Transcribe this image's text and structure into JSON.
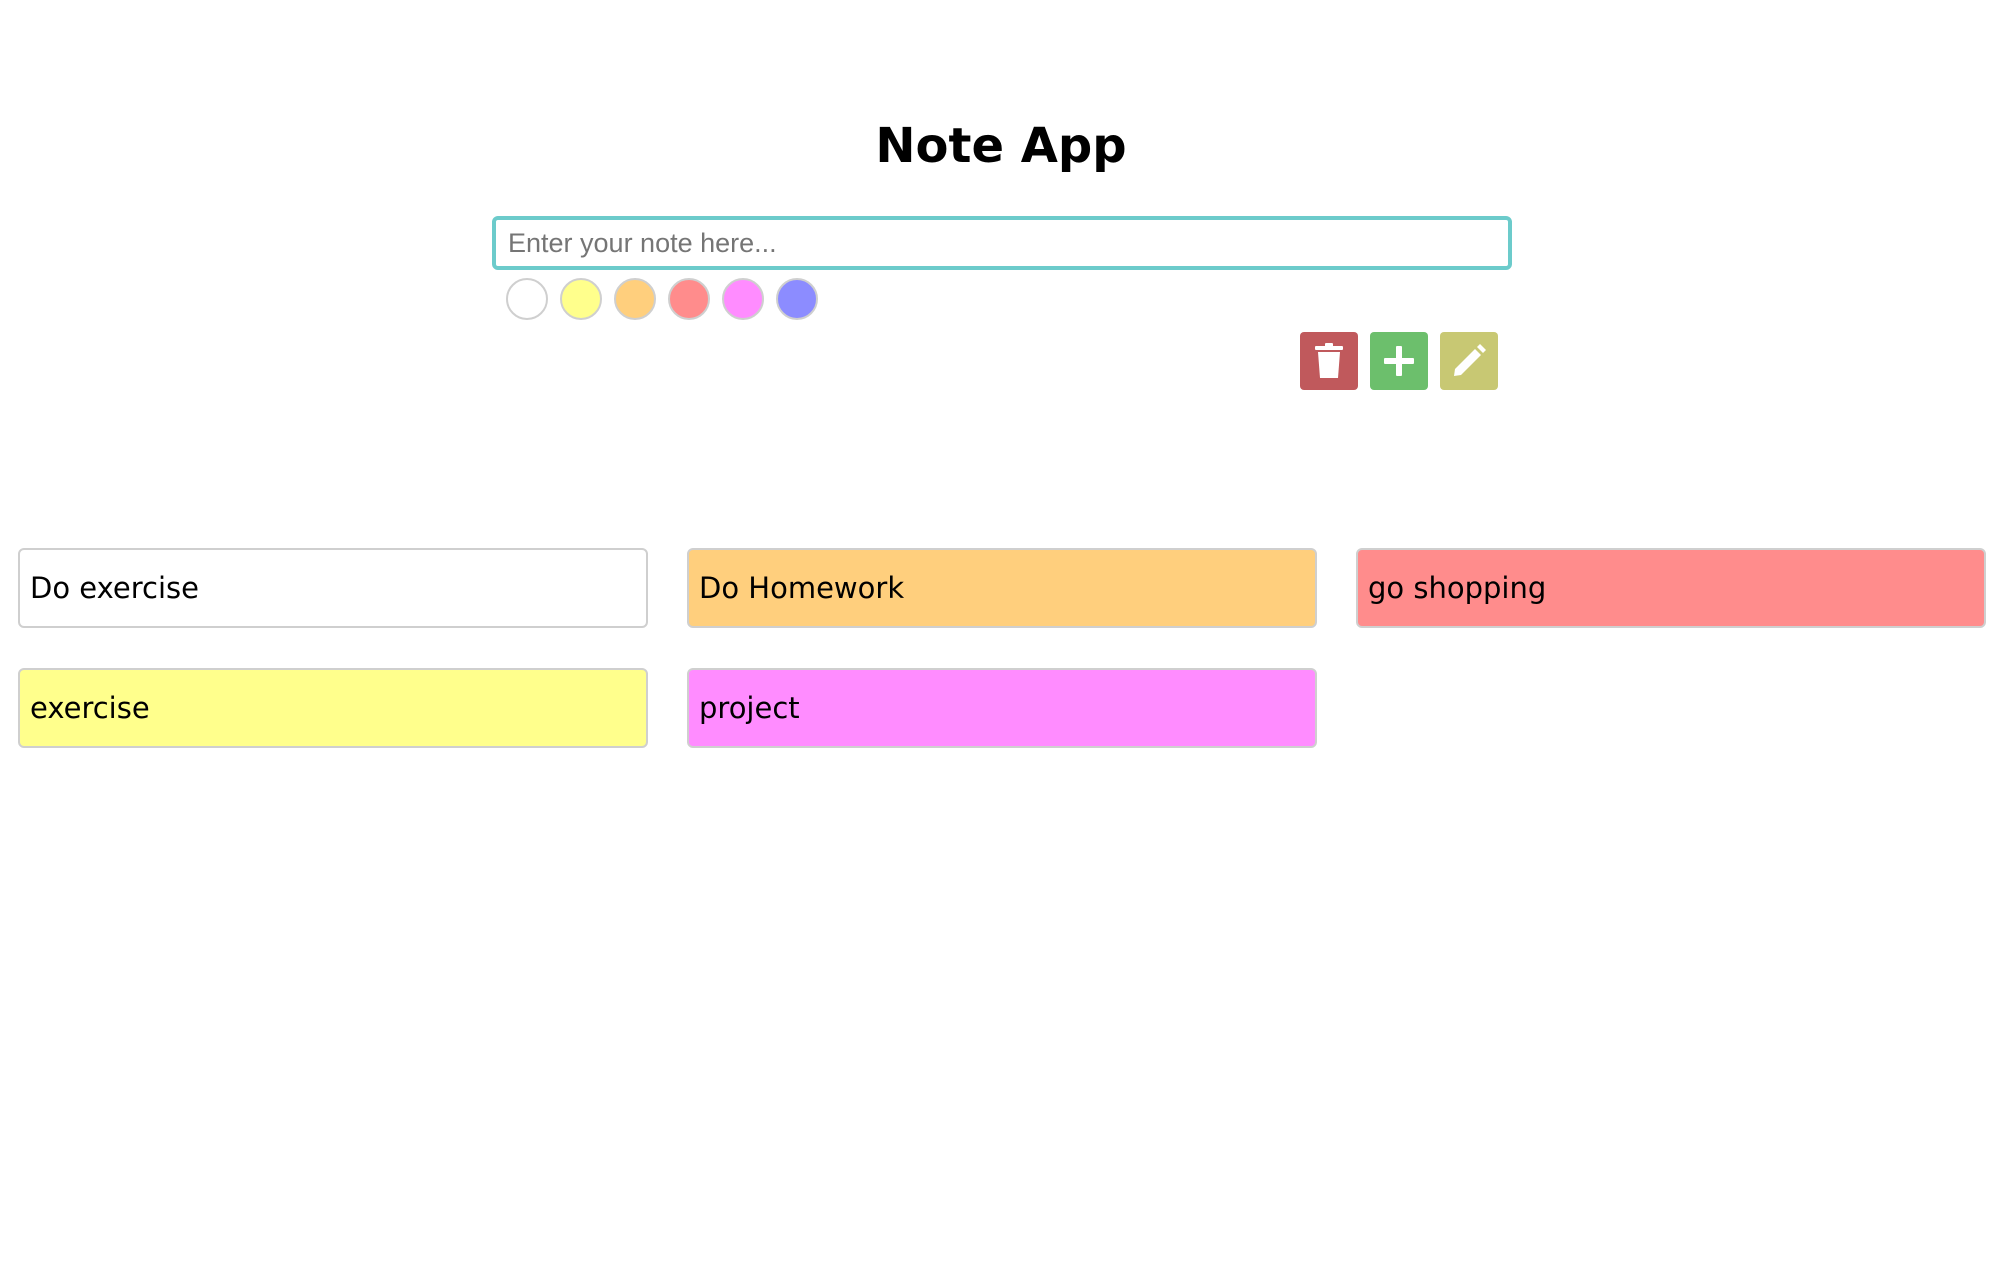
{
  "app": {
    "title": "Note App"
  },
  "input": {
    "placeholder": "Enter your note here...",
    "value": "",
    "border_color": "#6ccbcb"
  },
  "swatches": [
    {
      "name": "white",
      "color": "#ffffff"
    },
    {
      "name": "yellow",
      "color": "#ffff8c"
    },
    {
      "name": "orange",
      "color": "#ffcf7d"
    },
    {
      "name": "red",
      "color": "#ff8c8c"
    },
    {
      "name": "pink",
      "color": "#ff8cff"
    },
    {
      "name": "blue",
      "color": "#8c8cff"
    }
  ],
  "actions": [
    {
      "name": "delete-button",
      "icon": "trash-icon",
      "color": "#c0595c"
    },
    {
      "name": "add-button",
      "icon": "plus-icon",
      "color": "#6cbf6c"
    },
    {
      "name": "edit-button",
      "icon": "pencil-icon",
      "color": "#c8c873"
    }
  ],
  "notes": [
    {
      "text": "Do exercise",
      "color": "#ffffff"
    },
    {
      "text": "Do Homework",
      "color": "#ffcf7d"
    },
    {
      "text": "go shopping",
      "color": "#ff8c8c"
    },
    {
      "text": "exercise",
      "color": "#ffff8c"
    },
    {
      "text": "project",
      "color": "#ff8cff"
    }
  ]
}
